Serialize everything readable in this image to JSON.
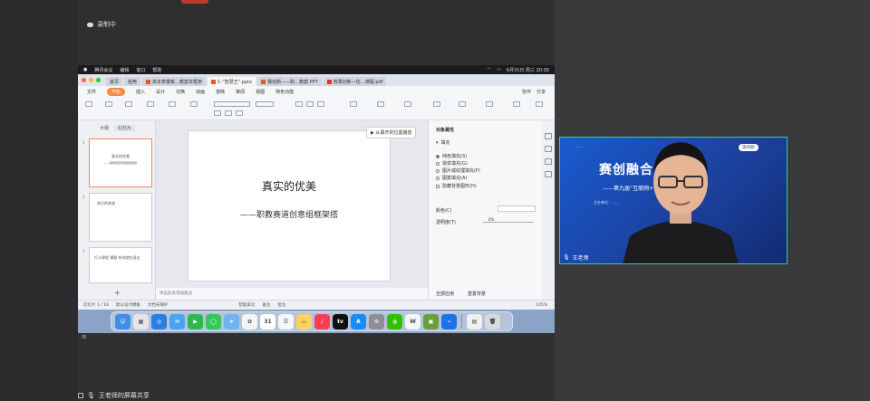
{
  "meeting": {
    "recording_label": "录制中",
    "share_label": "王老师的屏幕共享",
    "speaker_name": "王老师"
  },
  "mac": {
    "menubar": [
      "腾讯会议",
      "编辑",
      "窗口",
      "帮助"
    ],
    "clock": "6月31日 周三 20:30",
    "tabs": [
      {
        "label": "首页",
        "active": false
      },
      {
        "label": "稻壳",
        "active": false
      },
      {
        "label": "高本表模板…教案本框架",
        "active": false
      },
      {
        "label": "1-“智慧王”.pptx",
        "active": true
      },
      {
        "label": "赛创新——职…教案.PPT",
        "active": false
      },
      {
        "label": "效果创新—信…课程.pdf",
        "active": false
      }
    ],
    "ribbon_tabs": [
      "文件",
      "开始",
      "插入",
      "设计",
      "切换",
      "动画",
      "放映",
      "审阅",
      "视图",
      "特色功能"
    ],
    "ribbon_selected": "开始",
    "share_btn": "分享",
    "collab_btn": "协作",
    "panel_tabs": [
      "大纲",
      "幻灯片"
    ],
    "slides": [
      {
        "num": "1",
        "title": "真实的优美",
        "sub": "——职教赛道创意组框架搭"
      },
      {
        "num": "2",
        "title": "知识的来源"
      },
      {
        "num": "3",
        "title": "打卡课程 课题 有你就在身边"
      }
    ],
    "current_slide": {
      "title": "真实的优美",
      "subtitle": "——职教赛道创意组框架搭"
    },
    "float_tip": "从幕开的位置播放",
    "notes_placeholder": "单击此处添加备注",
    "props": {
      "header": "对象属性",
      "section": "填充",
      "options": [
        "纯色填充(S)",
        "渐变填充(G)",
        "图片或纹理填充(P)",
        "图案填充(A)",
        "隐藏背景图形(H)"
      ],
      "selected_index": 0,
      "color_label": "颜色(C)",
      "transparency_label": "透明度(T)",
      "transparency_value": "0%",
      "apply_all": "全部应用",
      "reset": "重置背景"
    },
    "status": {
      "slide_index": "幻灯片 1 / 18",
      "theme": "默认设计模板",
      "backup": "文档未保护",
      "zoom_label": "智能美化",
      "notes": "备注",
      "comments": "批注",
      "zoom": "105%"
    }
  },
  "dock_apps": [
    {
      "name": "finder",
      "color": "#3d8fe8",
      "glyph": "☺"
    },
    {
      "name": "launchpad",
      "color": "#e5e5e5",
      "glyph": "▦"
    },
    {
      "name": "safari",
      "color": "#2b7de0",
      "glyph": "◎"
    },
    {
      "name": "mail",
      "color": "#4aa3f0",
      "glyph": "✉"
    },
    {
      "name": "facetime",
      "color": "#2fb84e",
      "glyph": "▶"
    },
    {
      "name": "messages",
      "color": "#35c759",
      "glyph": "◯"
    },
    {
      "name": "maps",
      "color": "#6fb4f0",
      "glyph": "➤"
    },
    {
      "name": "photos",
      "color": "#f4f4f4",
      "glyph": "✿"
    },
    {
      "name": "calendar",
      "color": "#ffffff",
      "glyph": "31"
    },
    {
      "name": "reminders",
      "color": "#f7f7f7",
      "glyph": "☰"
    },
    {
      "name": "notes",
      "color": "#f8d35e",
      "glyph": "▭"
    },
    {
      "name": "music",
      "color": "#fa3c55",
      "glyph": "♪"
    },
    {
      "name": "tv",
      "color": "#111111",
      "glyph": "tv"
    },
    {
      "name": "app-store",
      "color": "#1a8cf5",
      "glyph": "A"
    },
    {
      "name": "settings",
      "color": "#8e8e93",
      "glyph": "⚙"
    },
    {
      "name": "wechat",
      "color": "#2dc100",
      "glyph": "◍"
    },
    {
      "name": "wps",
      "color": "#f5f5f5",
      "glyph": "W"
    },
    {
      "name": "minecraft",
      "color": "#6a9f3a",
      "glyph": "▣"
    },
    {
      "name": "tencent-meeting",
      "color": "#1a73e8",
      "glyph": "⌁"
    },
    {
      "name": "document",
      "color": "#f0f0f0",
      "glyph": "▤"
    },
    {
      "name": "trash",
      "color": "#d8dadd",
      "glyph": "🗑"
    }
  ],
  "webcam": {
    "banner_title": "赛创融合 启程学",
    "banner_sub": "——第九届“互联网+” ……能力提升",
    "banner_small": "主办单位：……",
    "badge": "第四期",
    "logo_text": "……"
  },
  "colors": {
    "accent": "#f58a42",
    "banner_blue": "#1b4fb0",
    "cam_border": "#2dd3a0"
  }
}
